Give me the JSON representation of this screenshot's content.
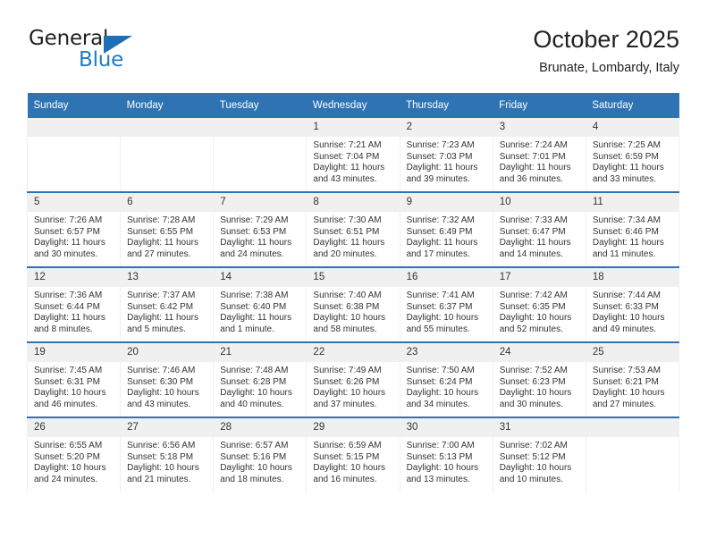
{
  "brand": {
    "word_one": "General",
    "word_two": "Blue",
    "triangle_icon": "triangle-icon"
  },
  "header": {
    "title": "October 2025",
    "subtitle": "Brunate, Lombardy, Italy"
  },
  "colors": {
    "header_blue": "#2f73b3",
    "row_rule_blue": "#2f73b3",
    "daynum_grey": "#f0f0f0",
    "brand_blue": "#1f7bc1"
  },
  "weekday_headers": [
    "Sunday",
    "Monday",
    "Tuesday",
    "Wednesday",
    "Thursday",
    "Friday",
    "Saturday"
  ],
  "weeks": [
    [
      {
        "day": "",
        "empty": true,
        "lines": []
      },
      {
        "day": "",
        "empty": true,
        "lines": []
      },
      {
        "day": "",
        "empty": true,
        "lines": []
      },
      {
        "day": "1",
        "empty": false,
        "lines": [
          "Sunrise: 7:21 AM",
          "Sunset: 7:04 PM",
          "Daylight: 11 hours",
          "and 43 minutes."
        ]
      },
      {
        "day": "2",
        "empty": false,
        "lines": [
          "Sunrise: 7:23 AM",
          "Sunset: 7:03 PM",
          "Daylight: 11 hours",
          "and 39 minutes."
        ]
      },
      {
        "day": "3",
        "empty": false,
        "lines": [
          "Sunrise: 7:24 AM",
          "Sunset: 7:01 PM",
          "Daylight: 11 hours",
          "and 36 minutes."
        ]
      },
      {
        "day": "4",
        "empty": false,
        "lines": [
          "Sunrise: 7:25 AM",
          "Sunset: 6:59 PM",
          "Daylight: 11 hours",
          "and 33 minutes."
        ]
      }
    ],
    [
      {
        "day": "5",
        "empty": false,
        "lines": [
          "Sunrise: 7:26 AM",
          "Sunset: 6:57 PM",
          "Daylight: 11 hours",
          "and 30 minutes."
        ]
      },
      {
        "day": "6",
        "empty": false,
        "lines": [
          "Sunrise: 7:28 AM",
          "Sunset: 6:55 PM",
          "Daylight: 11 hours",
          "and 27 minutes."
        ]
      },
      {
        "day": "7",
        "empty": false,
        "lines": [
          "Sunrise: 7:29 AM",
          "Sunset: 6:53 PM",
          "Daylight: 11 hours",
          "and 24 minutes."
        ]
      },
      {
        "day": "8",
        "empty": false,
        "lines": [
          "Sunrise: 7:30 AM",
          "Sunset: 6:51 PM",
          "Daylight: 11 hours",
          "and 20 minutes."
        ]
      },
      {
        "day": "9",
        "empty": false,
        "lines": [
          "Sunrise: 7:32 AM",
          "Sunset: 6:49 PM",
          "Daylight: 11 hours",
          "and 17 minutes."
        ]
      },
      {
        "day": "10",
        "empty": false,
        "lines": [
          "Sunrise: 7:33 AM",
          "Sunset: 6:47 PM",
          "Daylight: 11 hours",
          "and 14 minutes."
        ]
      },
      {
        "day": "11",
        "empty": false,
        "lines": [
          "Sunrise: 7:34 AM",
          "Sunset: 6:46 PM",
          "Daylight: 11 hours",
          "and 11 minutes."
        ]
      }
    ],
    [
      {
        "day": "12",
        "empty": false,
        "lines": [
          "Sunrise: 7:36 AM",
          "Sunset: 6:44 PM",
          "Daylight: 11 hours",
          "and 8 minutes."
        ]
      },
      {
        "day": "13",
        "empty": false,
        "lines": [
          "Sunrise: 7:37 AM",
          "Sunset: 6:42 PM",
          "Daylight: 11 hours",
          "and 5 minutes."
        ]
      },
      {
        "day": "14",
        "empty": false,
        "lines": [
          "Sunrise: 7:38 AM",
          "Sunset: 6:40 PM",
          "Daylight: 11 hours",
          "and 1 minute."
        ]
      },
      {
        "day": "15",
        "empty": false,
        "lines": [
          "Sunrise: 7:40 AM",
          "Sunset: 6:38 PM",
          "Daylight: 10 hours",
          "and 58 minutes."
        ]
      },
      {
        "day": "16",
        "empty": false,
        "lines": [
          "Sunrise: 7:41 AM",
          "Sunset: 6:37 PM",
          "Daylight: 10 hours",
          "and 55 minutes."
        ]
      },
      {
        "day": "17",
        "empty": false,
        "lines": [
          "Sunrise: 7:42 AM",
          "Sunset: 6:35 PM",
          "Daylight: 10 hours",
          "and 52 minutes."
        ]
      },
      {
        "day": "18",
        "empty": false,
        "lines": [
          "Sunrise: 7:44 AM",
          "Sunset: 6:33 PM",
          "Daylight: 10 hours",
          "and 49 minutes."
        ]
      }
    ],
    [
      {
        "day": "19",
        "empty": false,
        "lines": [
          "Sunrise: 7:45 AM",
          "Sunset: 6:31 PM",
          "Daylight: 10 hours",
          "and 46 minutes."
        ]
      },
      {
        "day": "20",
        "empty": false,
        "lines": [
          "Sunrise: 7:46 AM",
          "Sunset: 6:30 PM",
          "Daylight: 10 hours",
          "and 43 minutes."
        ]
      },
      {
        "day": "21",
        "empty": false,
        "lines": [
          "Sunrise: 7:48 AM",
          "Sunset: 6:28 PM",
          "Daylight: 10 hours",
          "and 40 minutes."
        ]
      },
      {
        "day": "22",
        "empty": false,
        "lines": [
          "Sunrise: 7:49 AM",
          "Sunset: 6:26 PM",
          "Daylight: 10 hours",
          "and 37 minutes."
        ]
      },
      {
        "day": "23",
        "empty": false,
        "lines": [
          "Sunrise: 7:50 AM",
          "Sunset: 6:24 PM",
          "Daylight: 10 hours",
          "and 34 minutes."
        ]
      },
      {
        "day": "24",
        "empty": false,
        "lines": [
          "Sunrise: 7:52 AM",
          "Sunset: 6:23 PM",
          "Daylight: 10 hours",
          "and 30 minutes."
        ]
      },
      {
        "day": "25",
        "empty": false,
        "lines": [
          "Sunrise: 7:53 AM",
          "Sunset: 6:21 PM",
          "Daylight: 10 hours",
          "and 27 minutes."
        ]
      }
    ],
    [
      {
        "day": "26",
        "empty": false,
        "lines": [
          "Sunrise: 6:55 AM",
          "Sunset: 5:20 PM",
          "Daylight: 10 hours",
          "and 24 minutes."
        ]
      },
      {
        "day": "27",
        "empty": false,
        "lines": [
          "Sunrise: 6:56 AM",
          "Sunset: 5:18 PM",
          "Daylight: 10 hours",
          "and 21 minutes."
        ]
      },
      {
        "day": "28",
        "empty": false,
        "lines": [
          "Sunrise: 6:57 AM",
          "Sunset: 5:16 PM",
          "Daylight: 10 hours",
          "and 18 minutes."
        ]
      },
      {
        "day": "29",
        "empty": false,
        "lines": [
          "Sunrise: 6:59 AM",
          "Sunset: 5:15 PM",
          "Daylight: 10 hours",
          "and 16 minutes."
        ]
      },
      {
        "day": "30",
        "empty": false,
        "lines": [
          "Sunrise: 7:00 AM",
          "Sunset: 5:13 PM",
          "Daylight: 10 hours",
          "and 13 minutes."
        ]
      },
      {
        "day": "31",
        "empty": false,
        "lines": [
          "Sunrise: 7:02 AM",
          "Sunset: 5:12 PM",
          "Daylight: 10 hours",
          "and 10 minutes."
        ]
      },
      {
        "day": "",
        "empty": true,
        "lines": []
      }
    ]
  ]
}
